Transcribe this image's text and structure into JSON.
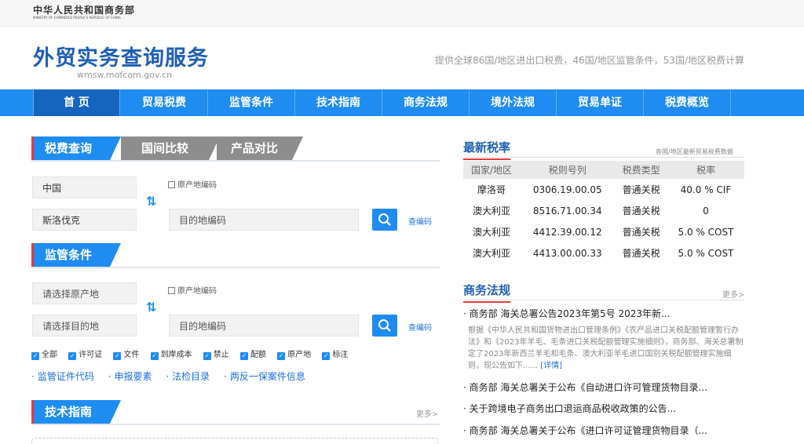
{
  "header": {
    "ministry_cn": "中华人民共和国商务部",
    "ministry_en": "MINISTRY OF COMMERCE PEOPLE'S REPUBLIC OF CHINA",
    "site_title": "外贸实务查询服务",
    "domain": "wmsw.mofcom.gov.cn",
    "tagline": "提供全球86国/地区进出口税费，46国/地区监管条件，53国/地区税费计算"
  },
  "nav": [
    "首 页",
    "贸易税费",
    "监管条件",
    "技术指南",
    "商务法规",
    "境外法规",
    "贸易单证",
    "税费概览"
  ],
  "tax_query": {
    "tabs": [
      "税费查询",
      "国间比较",
      "产品对比"
    ],
    "origin_value": "中国",
    "origin_code_checkbox": "原产地编码",
    "destination_value": "斯洛伐克",
    "destination_code_placeholder": "目的地编码",
    "lookup_link": "查编码"
  },
  "regulation": {
    "title": "监管条件",
    "origin_placeholder": "请选择原产地",
    "origin_code_checkbox": "原产地编码",
    "destination_placeholder": "请选择目的地",
    "destination_code_placeholder": "目的地编码",
    "lookup_link": "查编码",
    "filters": [
      "全部",
      "许可证",
      "文件",
      "到岸成本",
      "禁止",
      "配额",
      "原产地",
      "标注"
    ],
    "links": [
      "监管证件代码",
      "申报要素",
      "法检目录",
      "两反一保案件信息"
    ]
  },
  "tech_guide": {
    "title": "技术指南",
    "more": "更多>"
  },
  "latest_rates": {
    "title": "最新税率",
    "subtitle": "各国/地区最新贸易税费数据",
    "columns": [
      "国家/地区",
      "税则号列",
      "税费类型",
      "税率"
    ],
    "rows": [
      [
        "摩洛哥",
        "0306.19.00.05",
        "普通关税",
        "40.0 % CIF"
      ],
      [
        "澳大利亚",
        "8516.71.00.34",
        "普通关税",
        "0"
      ],
      [
        "澳大利亚",
        "4412.39.00.12",
        "普通关税",
        "5.0 % COST"
      ],
      [
        "澳大利亚",
        "4413.00.00.33",
        "普通关税",
        "5.0 % COST"
      ]
    ]
  },
  "commerce_law": {
    "title": "商务法规",
    "more": "更多>",
    "items": [
      "商务部 海关总署公告2023年第5号 2023年新...",
      "商务部 海关总署关于公布《自动进口许可管理货物目录...",
      "关于跨境电子商务出口退运商品税收政策的公告...",
      "商务部 海关总署关于公布《进口许可证管理货物目录（..."
    ],
    "detail": "根据《中华人民共和国货物进出口管理条例》《农产品进口关税配额管理暂行办法》和《2023年羊毛、毛条进口关税配额管理实施细则》，商务部、海关总署制定了2023年新西兰羊毛和毛条、澳大利亚羊毛进口国别关税配额管理实施细则，现公告如下......",
    "detail_link": "[详情]"
  }
}
